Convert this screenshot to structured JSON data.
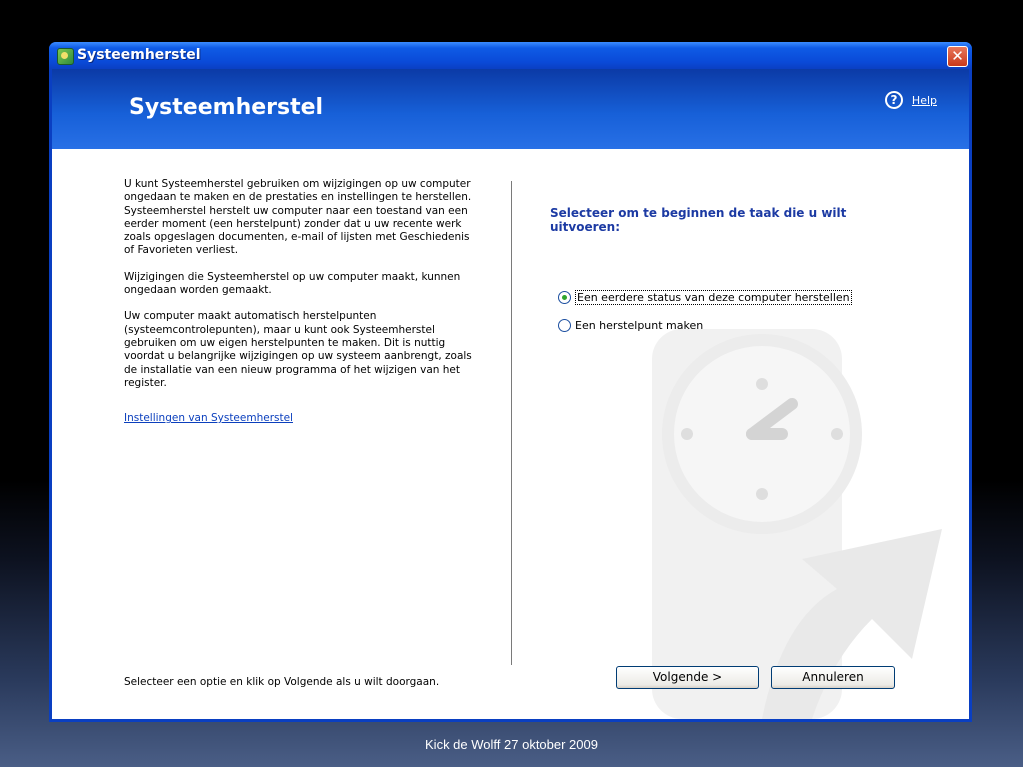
{
  "window": {
    "title": "Systeemherstel",
    "close_symbol": "✕"
  },
  "header": {
    "title": "Systeemherstel",
    "help_label": "Help",
    "help_symbol": "?"
  },
  "left": {
    "paragraphs": [
      "U kunt Systeemherstel gebruiken om wijzigingen op uw computer ongedaan te maken en de prestaties en instellingen te herstellen. Systeemherstel herstelt uw computer naar een toestand van een eerder moment (een herstelpunt) zonder dat u uw recente werk zoals opgeslagen documenten, e-mail of lijsten met Geschiedenis of Favorieten verliest.",
      "Wijzigingen die Systeemherstel op uw computer maakt, kunnen ongedaan worden gemaakt.",
      "Uw computer maakt automatisch herstelpunten (systeemcontrolepunten), maar u kunt ook Systeemherstel gebruiken om uw eigen herstelpunten te maken. Dit is nuttig voordat u belangrijke wijzigingen op uw systeem aanbrengt, zoals de installatie van een nieuw programma of het wijzigen van het register."
    ],
    "settings_link": "Instellingen van Systeemherstel",
    "footer": "Selecteer een optie en klik op Volgende als u wilt doorgaan."
  },
  "right": {
    "heading": "Selecteer om te beginnen de taak die u wilt uitvoeren:",
    "options": [
      {
        "label": "Een eerdere status van deze computer herstellen",
        "selected": true
      },
      {
        "label": "Een herstelpunt maken",
        "selected": false
      }
    ]
  },
  "buttons": {
    "next": "Volgende >",
    "cancel": "Annuleren"
  },
  "caption": "Kick de Wolff  27 oktober 2009",
  "colors": {
    "titlebar": "#0a3fc2",
    "header": "#1760d8",
    "link": "#0b3fbd",
    "heading": "#1c3aa3"
  }
}
